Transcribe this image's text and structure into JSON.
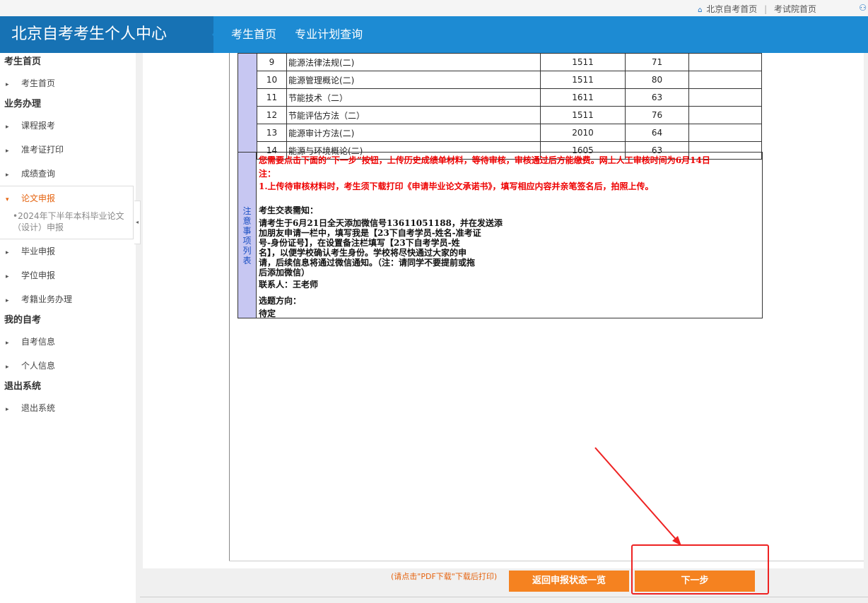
{
  "topbar": {
    "links": [
      "北京自考首页",
      "考试院首页"
    ],
    "separator": "|"
  },
  "header": {
    "brand": "北京自考考生个人中心",
    "nav": [
      "考生首页",
      "专业计划查询"
    ]
  },
  "sidebar": {
    "sections": [
      {
        "title": "考生首页",
        "items": [
          "考生首页"
        ]
      },
      {
        "title": "业务办理",
        "items": [
          "课程报考",
          "准考证打印",
          "成绩查询",
          "论文申报",
          "毕业申报",
          "学位申报",
          "考籍业务办理"
        ]
      },
      {
        "title": "我的自考",
        "items": [
          "自考信息",
          "个人信息"
        ]
      },
      {
        "title": "退出系统",
        "items": [
          "退出系统"
        ]
      }
    ],
    "active_item": "论文申报",
    "active_subitem": "•2024年下半年本科毕业论文（设计）申报",
    "collapse_glyph": "◂"
  },
  "grades": {
    "rows": [
      {
        "no": "9",
        "name": "能源法律法规(二)",
        "code": "1511",
        "score": "71"
      },
      {
        "no": "10",
        "name": "能源管理概论(二)",
        "code": "1511",
        "score": "80"
      },
      {
        "no": "11",
        "name": "节能技术（二）",
        "code": "1611",
        "score": "63"
      },
      {
        "no": "12",
        "name": "节能评估方法（二）",
        "code": "1511",
        "score": "76"
      },
      {
        "no": "13",
        "name": "能源审计方法(二)",
        "code": "2010",
        "score": "64"
      },
      {
        "no": "14",
        "name": "能源与环境概论(二)",
        "code": "1605",
        "score": "63"
      }
    ]
  },
  "notes": {
    "side_label": "注意事项列表",
    "red_line1": "您需要点击下面的“下一步”按钮，上传历史成绩单材料，等待审核，审核通过后方能缴费。网上人工审核时间为6月14日",
    "red_line2": "注：",
    "red_line3": "1.上传待审核材料时，考生须下载打印《申请毕业论文承诺书》，填写相应内容并亲笔签名后，拍照上传。",
    "heading": "考生交表需知：",
    "body_lines": [
      "请考生于6月21日全天添加微信号13611051188，并在发送添",
      "加朋友申请一栏中，填写我是【23下自考学员-姓名-准考证",
      "号-身份证号】，在设置备注栏填写【23下自考学员-姓",
      "名】，以便学校确认考生身份。学校将尽快通过大家的申",
      "请，后续信息将通过微信通知。（注：请同学不要提前或拖",
      "后添加微信）"
    ],
    "contact": "联系人：王老师",
    "topic_label": "选题方向：",
    "topic_value": "待定"
  },
  "footer": {
    "hint": "(请点击\"PDF下载\"下载后打印)",
    "back_button": "返回申报状态一览",
    "next_button": "下一步"
  },
  "colors": {
    "header_blue": "#1d8bd3",
    "brand_blue": "#1772b4",
    "accent_orange": "#f58220",
    "notice_red": "#e00000",
    "annotation_red": "#e22222"
  }
}
